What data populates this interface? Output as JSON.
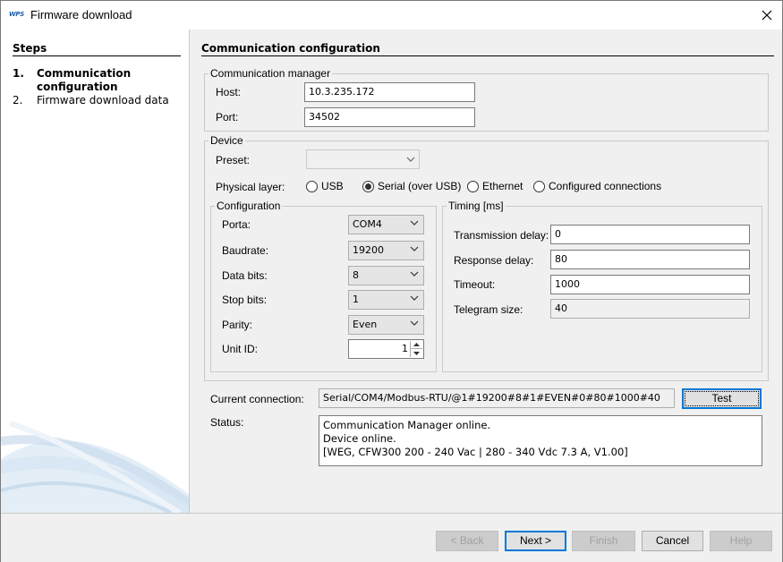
{
  "window": {
    "title": "Firmware download",
    "logo_text": "WPS"
  },
  "sidebar": {
    "title": "Steps",
    "steps": [
      {
        "num": "1.",
        "label": "Communication configuration"
      },
      {
        "num": "2.",
        "label": "Firmware download data"
      }
    ]
  },
  "main": {
    "title": "Communication configuration"
  },
  "comm_manager": {
    "legend": "Communication manager",
    "host_label": "Host:",
    "host_value": "10.3.235.172",
    "port_label": "Port:",
    "port_value": "34502"
  },
  "device": {
    "legend": "Device",
    "preset_label": "Preset:",
    "preset_value": "",
    "physical_layer_label": "Physical layer:",
    "physical_options": [
      {
        "label": "USB",
        "selected": false
      },
      {
        "label": "Serial (over USB)",
        "selected": true
      },
      {
        "label": "Ethernet",
        "selected": false
      },
      {
        "label": "Configured connections",
        "selected": false
      }
    ]
  },
  "configuration": {
    "legend": "Configuration",
    "porta_label": "Porta:",
    "porta_value": "COM4",
    "baudrate_label": "Baudrate:",
    "baudrate_value": "19200",
    "databits_label": "Data bits:",
    "databits_value": "8",
    "stopbits_label": "Stop bits:",
    "stopbits_value": "1",
    "parity_label": "Parity:",
    "parity_value": "Even",
    "unitid_label": "Unit ID:",
    "unitid_value": "1"
  },
  "timing": {
    "legend": "Timing [ms]",
    "tx_delay_label": "Transmission delay:",
    "tx_delay_value": "0",
    "resp_delay_label": "Response delay:",
    "resp_delay_value": "80",
    "timeout_label": "Timeout:",
    "timeout_value": "1000",
    "telegram_label": "Telegram size:",
    "telegram_value": "40"
  },
  "connection": {
    "label": "Current connection:",
    "value": "Serial/COM4/Modbus-RTU/@1#19200#8#1#EVEN#0#80#1000#40",
    "test_label": "Test"
  },
  "status": {
    "label": "Status:",
    "lines": [
      "Communication Manager online.",
      "Device online.",
      "[WEG, CFW300 200 - 240 Vac | 280 - 340 Vdc 7.3 A, V1.00]"
    ]
  },
  "footer": {
    "back_label": "< Back",
    "next_label": "Next >",
    "finish_label": "Finish",
    "cancel_label": "Cancel",
    "help_label": "Help"
  },
  "colors": {
    "accent": "#0078d7",
    "sidebar_bg": "#ffffff",
    "dialog_bg": "#f0f0f0"
  }
}
